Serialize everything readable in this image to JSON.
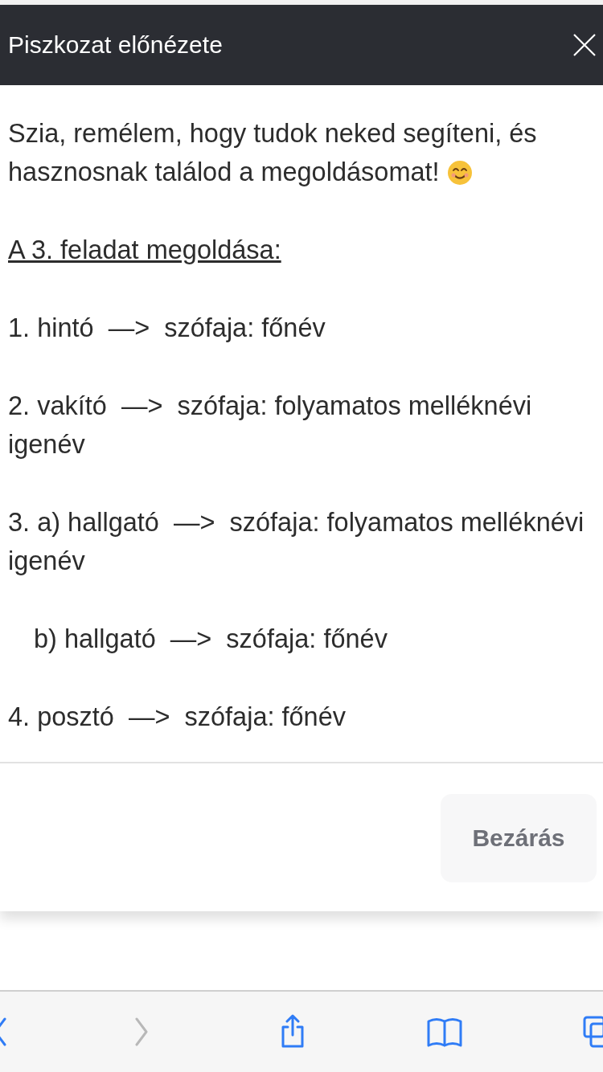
{
  "dialog": {
    "title": "Piszkozat előnézete",
    "paragraphs": [
      {
        "kind": "greeting",
        "text": "Szia, remélem, hogy tudok neked segíteni, és hasznosnak találod a megoldásomat!"
      },
      {
        "kind": "heading",
        "text": "A 3. feladat megoldása:"
      },
      {
        "kind": "plain",
        "text": "1. hintó  —>  szófaja: főnév"
      },
      {
        "kind": "plain",
        "text": "2. vakító  —>  szófaja: folyamatos melléknévi igenév"
      },
      {
        "kind": "plain",
        "text": "3. a) hallgató  —>  szófaja: folyamatos melléknévi igenév"
      },
      {
        "kind": "indented",
        "text": "b) hallgató  —>  szófaja: főnév"
      },
      {
        "kind": "plain",
        "text": "4. posztó  —>  szófaja: főnév"
      }
    ],
    "close_button": "Bezárás"
  },
  "toolbar": {
    "buttons": [
      {
        "kind": "back",
        "disabled": false
      },
      {
        "kind": "forward",
        "disabled": true
      },
      {
        "kind": "share",
        "disabled": false
      },
      {
        "kind": "bookmarks",
        "disabled": false
      },
      {
        "kind": "tabs",
        "disabled": false
      }
    ]
  }
}
